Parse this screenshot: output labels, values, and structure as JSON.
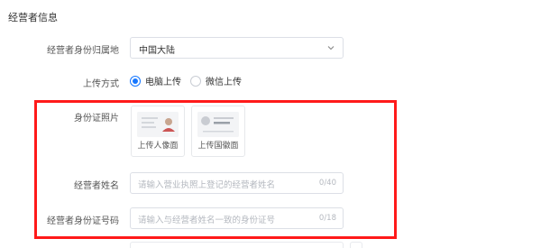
{
  "section": {
    "title": "经营者信息"
  },
  "region": {
    "label": "经营者身份归属地",
    "selected": "中国大陆"
  },
  "upload_method": {
    "label": "上传方式",
    "options": [
      "电脑上传",
      "微信上传"
    ],
    "selected_index": 0
  },
  "id_photo": {
    "label": "身份证照片",
    "portrait_caption": "上传人像面",
    "emblem_caption": "上传国徽面"
  },
  "name_field": {
    "label": "经营者姓名",
    "placeholder": "请输入营业执照上登记的经营者姓名",
    "count": "0/40"
  },
  "id_number_field": {
    "label": "经营者身份证号码",
    "placeholder": "请输入与经营者姓名一致的身份证号",
    "count": "0/18"
  },
  "colors": {
    "accent": "#1677ff",
    "highlight": "#ff1a1a"
  }
}
